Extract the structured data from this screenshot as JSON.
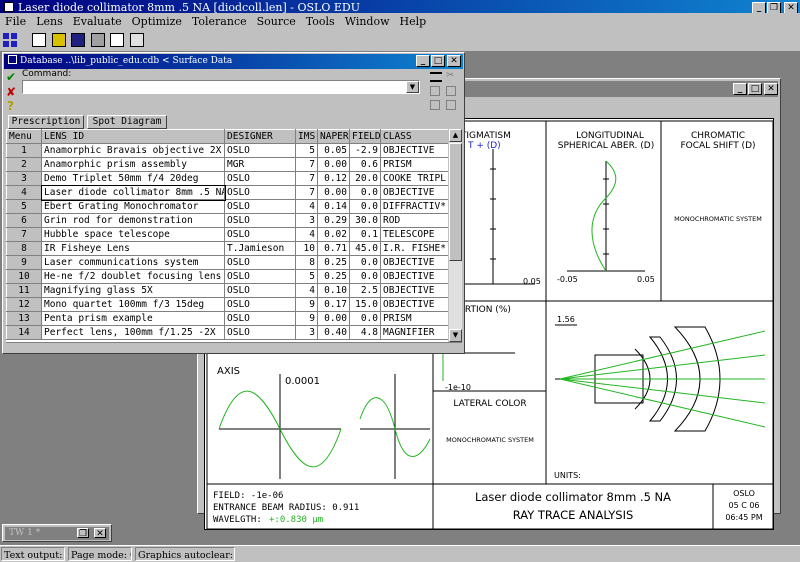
{
  "app": {
    "title": "Laser diode collimator 8mm .5 NA [diodcoll.len] - OSLO EDU"
  },
  "menu": [
    "File",
    "Lens",
    "Evaluate",
    "Optimize",
    "Tolerance",
    "Source",
    "Tools",
    "Window",
    "Help"
  ],
  "db_window": {
    "title": "Database ..\\lib_public_edu.cdb < Surface Data",
    "command_label": "Command:",
    "tabs": [
      "Prescription",
      "Spot Diagram"
    ]
  },
  "table": {
    "headers": [
      "Menu",
      "LENS ID",
      "DESIGNER",
      "IMS",
      "NAPER",
      "FIELD",
      "CLASS"
    ],
    "rows": [
      [
        "1",
        "Anamorphic Bravais objective 2X",
        "OSLO",
        "5",
        "0.05",
        "-2.9",
        "OBJECTIVE"
      ],
      [
        "2",
        "Anamorphic prism assembly",
        "MGR",
        "7",
        "0.00",
        "0.6",
        "PRISM"
      ],
      [
        "3",
        "Demo Triplet 50mm f/4 20deg",
        "OSLO",
        "7",
        "0.12",
        "20.0",
        "COOKE TRIPL"
      ],
      [
        "4",
        "Laser diode collimator 8mm .5 NA",
        "OSLO",
        "7",
        "0.00",
        "0.0",
        "OBJECTIVE"
      ],
      [
        "5",
        "Ebert Grating Monochromator",
        "OSLO",
        "4",
        "0.14",
        "0.0",
        "DIFFRACTIV*"
      ],
      [
        "6",
        "Grin rod for demonstration",
        "OSLO",
        "3",
        "0.29",
        "30.0",
        "ROD"
      ],
      [
        "7",
        "Hubble space telescope",
        "OSLO",
        "4",
        "0.02",
        "0.1",
        "TELESCOPE"
      ],
      [
        "8",
        "IR Fisheye Lens",
        "T.Jamieson",
        "10",
        "0.71",
        "45.0",
        "I.R. FISHE*"
      ],
      [
        "9",
        "Laser communications system",
        "OSLO",
        "8",
        "0.25",
        "0.0",
        "OBJECTIVE"
      ],
      [
        "10",
        "He-ne f/2 doublet focusing lens",
        "OSLO",
        "5",
        "0.25",
        "0.0",
        "OBJECTIVE"
      ],
      [
        "11",
        "Magnifying glass  5X",
        "OSLO",
        "4",
        "0.10",
        "2.5",
        "OBJECTIVE"
      ],
      [
        "12",
        "Mono quartet 100mm f/3 15deg",
        "OSLO",
        "9",
        "0.17",
        "15.0",
        "OBJECTIVE"
      ],
      [
        "13",
        "Penta prism example",
        "OSLO",
        "9",
        "0.00",
        "0.0",
        "PRISM"
      ],
      [
        "14",
        "Perfect lens, 100mm f/1.25 -2X",
        "OSLO",
        "3",
        "0.40",
        "4.8",
        "MAGNIFIER"
      ]
    ]
  },
  "analysis": {
    "astig": "ASTIGMATISM",
    "astig_legend": "S  ✕ T  + (D)",
    "astig_scale": "0.05",
    "long1": "LONGITUDINAL",
    "long2": "SPHERICAL ABER. (D)",
    "long_scale_left": "-0.05",
    "long_scale_right": "0.05",
    "chrom1": "CHROMATIC",
    "chrom2": "FOCAL SHIFT (D)",
    "chrom_note": "MONOCHROMATIC SYSTEM",
    "dist": "DISTORTION (%)",
    "dist_top": "0",
    "dist_bot": "-1e-10",
    "lens_scale": "1.56",
    "axis_label": "AXIS",
    "axis_scale": "0.0001",
    "lat": "LATERAL COLOR",
    "lat_note": "MONOCHROMATIC SYSTEM",
    "units": "UNITS:",
    "field": "FIELD: -1e-06",
    "ebr": "ENTRANCE BEAM RADIUS: 0.911",
    "wave_label": "WAVELGTH:",
    "wave_val": "+:0.830 µm",
    "title1": "Laser diode collimator 8mm .5 NA",
    "title2": "RAY TRACE ANALYSIS",
    "stamp1": "OSLO",
    "stamp2": "05 C 06",
    "stamp3": "06:45 PM"
  },
  "tw": {
    "title": "TW 1 *"
  },
  "status": [
    "Text output: On",
    "Page mode: On",
    "Graphics autoclear: On"
  ],
  "colors": {
    "curve": "#22b522",
    "dash": "#2222cc",
    "titlebar": "#000080"
  }
}
